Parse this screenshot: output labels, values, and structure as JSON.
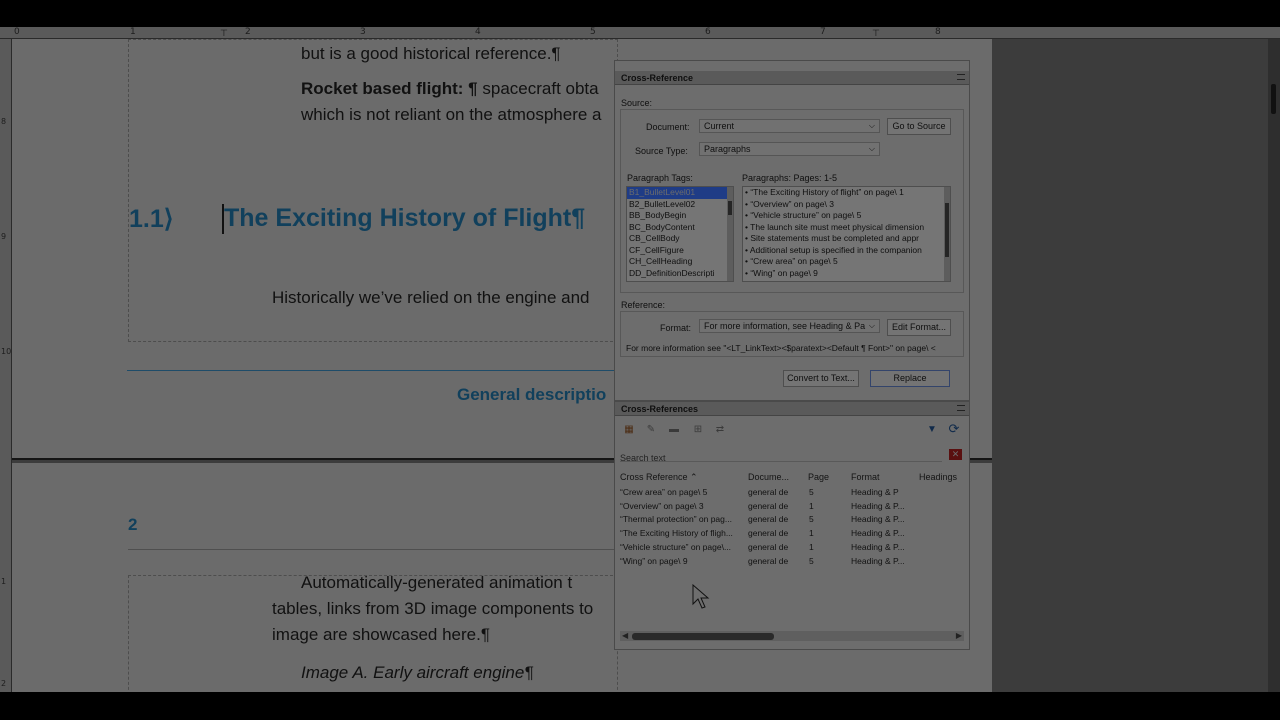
{
  "ruler": {
    "h_ticks": [
      "0",
      "1",
      "2",
      "3",
      "4",
      "5",
      "6",
      "7",
      "8"
    ],
    "v_ticks": [
      "8",
      "9",
      "10",
      "1",
      "2"
    ]
  },
  "document": {
    "page1": {
      "line1": "but is a good historical reference.¶",
      "rocket_bold": "Rocket based flight: ¶",
      "rocket_rest": " spacecraft obta",
      "rocket_line2": "which is not reliant on the atmosphere a",
      "heading_num": "1.1⟩",
      "heading_text": "The Exciting History of Flight¶",
      "para_hist": "Historically we’ve relied on the engine and",
      "general_desc": "General descriptio"
    },
    "page2": {
      "num": "2",
      "auto_line1": "Automatically-generated animation t",
      "auto_line2": "tables, links from 3D image components to",
      "auto_line3": "image are showcased here.¶",
      "caption": "Image A. Early aircraft engine¶"
    }
  },
  "xref_dialog": {
    "title": "Cross-Reference",
    "source_label": "Source:",
    "document_label": "Document:",
    "document_value": "Current",
    "go_to_source": "Go to Source",
    "source_type_label": "Source Type:",
    "source_type_value": "Paragraphs",
    "para_tags_label": "Paragraph Tags:",
    "para_tags": [
      "B1_BulletLevel01",
      "B2_BulletLevel02",
      "BB_BodyBegin",
      "BC_BodyContent",
      "CB_CellBody",
      "CF_CellFigure",
      "CH_CellHeading",
      "DD_DefinitionDescripti"
    ],
    "paragraphs_label": "Paragraphs: Pages: 1-5",
    "paragraphs": [
      "• “The Exciting History of flight” on page\\ 1",
      "• “Overview” on page\\ 3",
      "• “Vehicle structure” on page\\ 5",
      "• The launch site must meet physical dimension",
      "• Site statements must be completed and appr",
      "• Additional setup is specified in the companion",
      "• “Crew area” on page\\ 5",
      "• “Wing” on page\\ 9"
    ],
    "reference_label": "Reference:",
    "format_label": "Format:",
    "format_value": "For more information, see Heading & Pa",
    "edit_format": "Edit Format...",
    "format_preview": "For more information see \"<LT_LinkText><$paratext><Default ¶ Font>\" on page\\ <",
    "convert_to_text": "Convert to Text...",
    "replace": "Replace"
  },
  "xrefs_panel": {
    "title": "Cross-References",
    "search_placeholder": "Search text",
    "headers": [
      "Cross Reference ⌃",
      "Docume...",
      "Page",
      "Format",
      "Headings"
    ],
    "rows": [
      {
        "ref": "“Crew area” on page\\ 5",
        "doc": "general de",
        "page": "5",
        "format": "Heading & P"
      },
      {
        "ref": "“Overview” on page\\ 3",
        "doc": "general de",
        "page": "1",
        "format": "Heading & P..."
      },
      {
        "ref": "“Thermal protection” on pag...",
        "doc": "general de",
        "page": "5",
        "format": "Heading & P..."
      },
      {
        "ref": "“The Exciting History of fligh...",
        "doc": "general de",
        "page": "1",
        "format": "Heading & P..."
      },
      {
        "ref": "“Vehicle structure” on page\\...",
        "doc": "general de",
        "page": "1",
        "format": "Heading & P..."
      },
      {
        "ref": "“Wing” on page\\ 9",
        "doc": "general de",
        "page": "5",
        "format": "Heading & P..."
      }
    ]
  }
}
